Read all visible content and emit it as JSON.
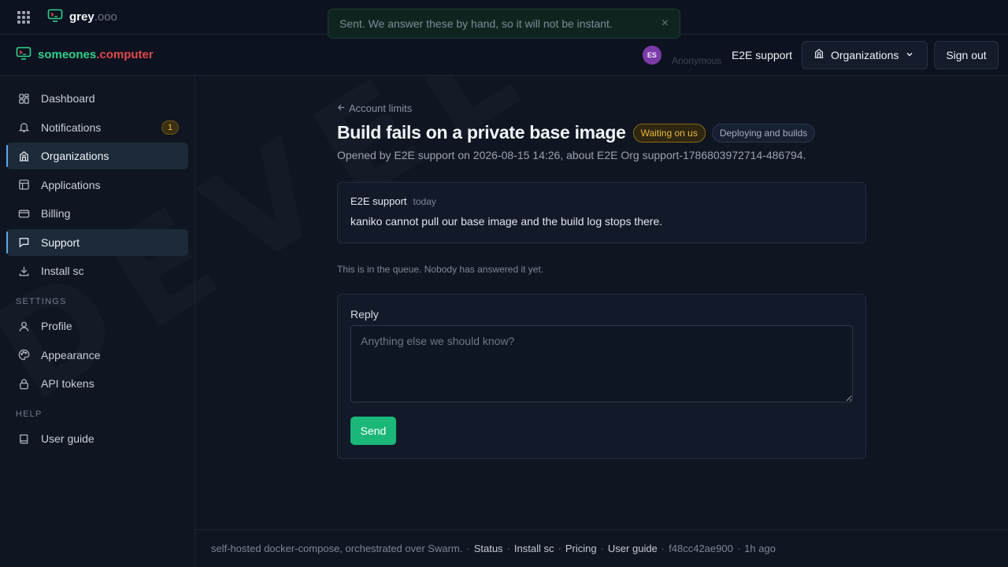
{
  "watermark": "DEVELOPMENT",
  "topbar": {
    "app_name": "grey",
    "app_suffix": ".ooo"
  },
  "toast": {
    "message": "Sent. We answer these by hand, so it will not be instant.",
    "close_glyph": "×"
  },
  "header": {
    "brand_part1": "someones",
    "brand_dot": ".",
    "brand_part2": "computer",
    "avatar_initials": "ES",
    "anon_label": "Anonymous",
    "user_name": "E2E support",
    "org_button": "Organizations",
    "signout_button": "Sign out"
  },
  "sidebar": {
    "items": [
      {
        "label": "Dashboard",
        "icon": "dashboard-icon"
      },
      {
        "label": "Notifications",
        "icon": "bell-icon",
        "badge": "1"
      },
      {
        "label": "Organizations",
        "icon": "building-icon",
        "active": true
      },
      {
        "label": "Applications",
        "icon": "layout-icon"
      },
      {
        "label": "Billing",
        "icon": "card-icon"
      },
      {
        "label": "Support",
        "icon": "chat-icon",
        "active": true
      },
      {
        "label": "Install sc",
        "icon": "download-icon"
      }
    ],
    "settings_label": "SETTINGS",
    "settings_items": [
      {
        "label": "Profile",
        "icon": "user-icon"
      },
      {
        "label": "Appearance",
        "icon": "palette-icon"
      },
      {
        "label": "API tokens",
        "icon": "lock-icon"
      }
    ],
    "help_label": "HELP",
    "help_items": [
      {
        "label": "User guide",
        "icon": "book-icon"
      }
    ]
  },
  "ticket": {
    "back_link": "Account limits",
    "title": "Build fails on a private base image",
    "status": "Waiting on us",
    "category": "Deploying and builds",
    "meta": "Opened by E2E support on 2026-08-15 14:26, about E2E Org support-1786803972714-486794.",
    "message": {
      "author": "E2E support",
      "time": "today",
      "body": "kaniko cannot pull our base image and the build log stops there."
    },
    "queue_note": "This is in the queue. Nobody has answered it yet.",
    "reply_label": "Reply",
    "reply_placeholder": "Anything else we should know?",
    "send_button": "Send"
  },
  "footer": {
    "text": "self-hosted docker-compose, orchestrated over Swarm.",
    "links": [
      "Status",
      "Install sc",
      "Pricing",
      "User guide"
    ],
    "commit": "f48cc42ae900",
    "age": "1h ago"
  },
  "colors": {
    "accent_green": "#1bb779",
    "brand_green": "#2fd08a",
    "brand_red": "#e04848",
    "warning": "#e9b93c"
  }
}
